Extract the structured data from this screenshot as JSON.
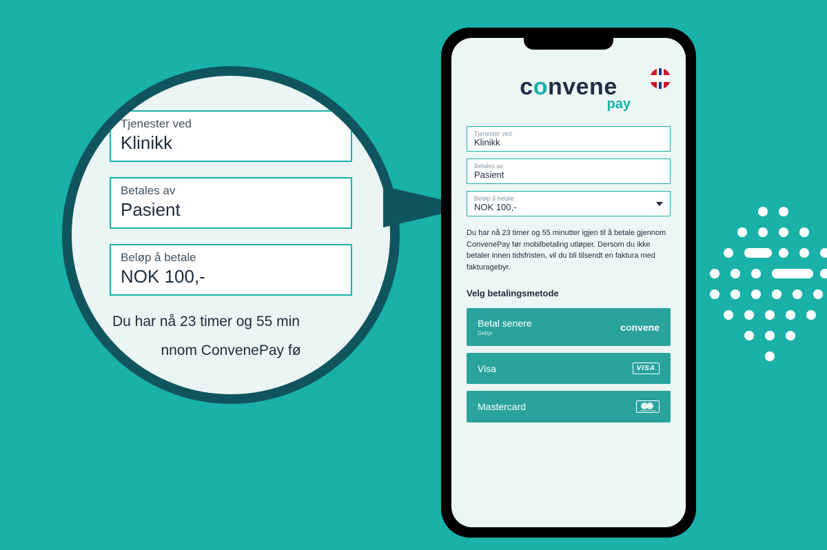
{
  "brand": {
    "name": "convene",
    "sub": "pay"
  },
  "fields": {
    "service": {
      "label": "Tjenester ved",
      "value": "Klinikk"
    },
    "payer": {
      "label": "Betales av",
      "value": "Pasient"
    },
    "amount": {
      "label": "Beløp å betale",
      "value": "NOK 100,-"
    }
  },
  "info_text": "Du har nå 23 timer og 55 minutter igjen til å betale gjennom ConvenePay før mobilbetaling utløper. Dersom du ikke betaler innen tidsfristen, vil du bli tilsendt en faktura med fakturagebyr.",
  "pay_section_title": "Velg betalingsmetode",
  "methods": {
    "later": {
      "label": "Betal senere",
      "sub": "Gebyr",
      "brand": "convene"
    },
    "visa": {
      "label": "Visa",
      "badge": "VISA"
    },
    "mc": {
      "label": "Mastercard",
      "badge_sub": "mastercard"
    }
  },
  "zoom": {
    "info_line1": "Du har nå 23 timer og 55 min",
    "info_line2": "nnom ConvenePay fø"
  }
}
